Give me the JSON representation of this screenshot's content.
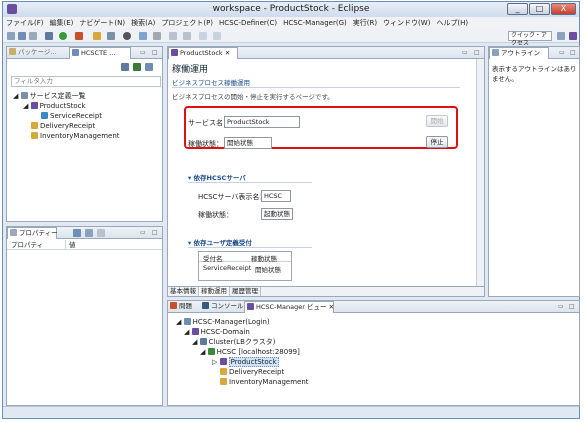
{
  "window": {
    "title": "workspace - ProductStock - Eclipse",
    "min": "_",
    "max": "□",
    "close": "X"
  },
  "menu": [
    "ファイル(F)",
    "編集(E)",
    "ナビゲート(N)",
    "検索(A)",
    "プロジェクト(P)",
    "HCSC-Definer(C)",
    "HCSC-Manager(G)",
    "実行(R)",
    "ウィンドウ(W)",
    "ヘルプ(H)"
  ],
  "toolbar": {
    "quick_access": "クイック・アクセス"
  },
  "left_panel": {
    "tabs": [
      "パッケージ...",
      "HCSCTE ..."
    ],
    "filter_placeholder": "フィルタ入力",
    "tree": [
      "サービス定義一覧",
      "ProductStock",
      "ServiceReceipt",
      "DeliveryReceipt",
      "InventoryManagement"
    ]
  },
  "props_panel": {
    "tabs": [
      "プロパティー"
    ],
    "headers": [
      "プロパティ",
      "値"
    ]
  },
  "editor": {
    "tab": "ProductStock",
    "title": "稼働運用",
    "section": "ビジネスプロセス稼働運用",
    "description": "ビジネスプロセスの開始・停止を実行するページです。",
    "service_label": "サービス名：",
    "service_value": "ProductStock",
    "start_button": "開始",
    "status_label": "稼働状態：",
    "status_value": "開始状態",
    "stop_button": "停止",
    "dep_server_title": "依存HCSCサーバ",
    "server_label": "HCSCサーバ表示名：",
    "server_value": "HCSC",
    "server_status_label": "稼働状態：",
    "server_status_value": "起動状態",
    "dep_receipt_title": "依存ユーザ定義受付",
    "receipt_headers": [
      "受付名",
      "稼動状態"
    ],
    "receipt_rows": [
      [
        "ServiceReceipt",
        "開始状態"
      ]
    ],
    "bottom_tabs": [
      "基本情報",
      "稼動運用",
      "履歴管理"
    ]
  },
  "outline": {
    "tab": "アウトライン",
    "message": "表示するアウトラインはありません。"
  },
  "bottom_panel": {
    "tabs": [
      "問題",
      "コンソール",
      "HCSC-Manager ビュー"
    ],
    "tree": [
      "HCSC-Manager(Login)",
      "HCSC-Domain",
      "Cluster(LBクラスタ)",
      "HCSC [localhost:28099]",
      "ProductStock",
      "DeliveryReceipt",
      "InventoryManagement"
    ]
  }
}
